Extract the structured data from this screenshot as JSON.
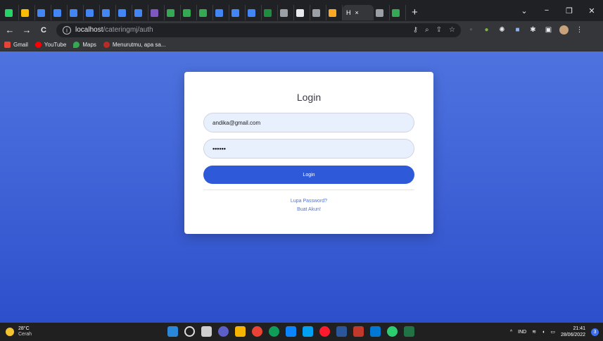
{
  "browser": {
    "active_tab": {
      "label": "H",
      "close": "×"
    },
    "new_tab": "+",
    "window_controls": {
      "minimize": "−",
      "maximize": "❐",
      "close": "✕"
    },
    "nav": {
      "back": "←",
      "forward": "→",
      "reload": "C"
    },
    "address": {
      "host": "localhost",
      "path": "/cateringmj/auth"
    },
    "bookmarks": [
      {
        "label": "Gmail"
      },
      {
        "label": "YouTube"
      },
      {
        "label": "Maps"
      },
      {
        "label": "Menurutmu, apa sa..."
      }
    ]
  },
  "login": {
    "title": "Login",
    "email_value": "andika@gmail.com",
    "password_value": "••••••",
    "button_label": "Login",
    "forgot_label": "Lupa Password?",
    "register_label": "Buat Akun!"
  },
  "taskbar": {
    "weather": {
      "temp": "28°C",
      "condition": "Cerah"
    },
    "language": "IND",
    "time": "21:41",
    "date": "28/06/2022",
    "notification_count": "3"
  },
  "colors": {
    "primary": "#4e73df",
    "button": "#2e59d9",
    "input_bg": "#e8f0fe"
  }
}
